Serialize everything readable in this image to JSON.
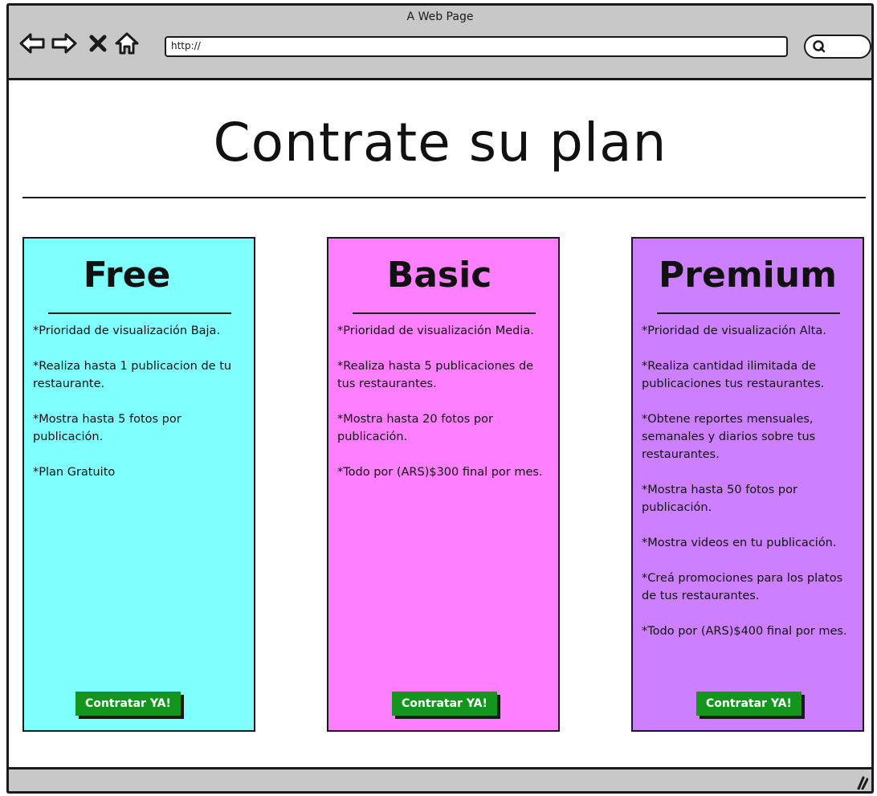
{
  "window": {
    "title": "A Web Page",
    "url": "http://"
  },
  "page": {
    "heading": "Contrate su plan"
  },
  "plans": [
    {
      "name": "Free",
      "color": "#80ffff",
      "features": [
        "*Prioridad de visualización Baja.",
        "*Realiza hasta 1 publicacion de tu restaurante.",
        "*Mostra hasta 5 fotos por publicación.",
        "*Plan Gratuito"
      ],
      "cta_label": "Contratar YA!"
    },
    {
      "name": "Basic",
      "color": "#ff80ff",
      "features": [
        "*Prioridad de visualización Media.",
        "*Realiza hasta 5 publicaciones de tus restaurantes.",
        "*Mostra hasta 20 fotos por publicación.",
        "*Todo por (ARS)$300 final por mes."
      ],
      "cta_label": "Contratar YA!"
    },
    {
      "name": "Premium",
      "color": "#cc80ff",
      "features": [
        "*Prioridad de visualización Alta.",
        "*Realiza cantidad ilimitada de publicaciones tus restaurantes.",
        "*Obtene reportes mensuales, semanales y diarios sobre tus restaurantes.",
        "*Mostra hasta 50 fotos por publicación.",
        "*Mostra videos en tu publicación.",
        "*Creá promociones para los platos de tus restaurantes.",
        "*Todo por (ARS)$400 final por mes."
      ],
      "cta_label": "Contratar YA!"
    }
  ],
  "colors": {
    "chrome": "#c8c8c8",
    "cta": "#14961e"
  },
  "icons": {
    "back": "back-arrow-icon",
    "forward": "forward-arrow-icon",
    "stop": "close-icon",
    "home": "home-icon",
    "search": "search-icon",
    "resize": "resize-grip-icon"
  }
}
